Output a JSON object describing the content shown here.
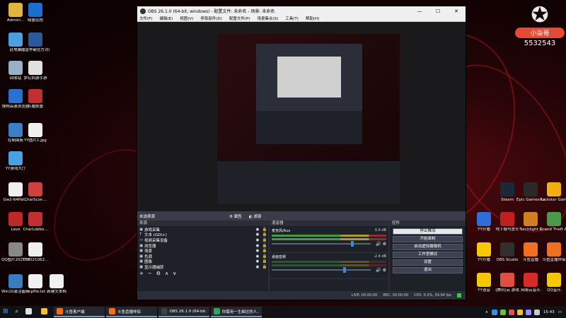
{
  "desktop": {
    "left_icons": [
      {
        "label": "Admini...",
        "color": "#e2b440"
      },
      {
        "label": "绿盟远程",
        "color": "#1a6fd1"
      },
      {
        "label": "此电脑",
        "color": "#4aa0e0"
      },
      {
        "label": "魔兽争霸官方对战平台",
        "color": "#2a5a9a"
      },
      {
        "label": "回收站",
        "color": "#9ab0c8"
      },
      {
        "label": "梦幻西游手游",
        "color": "#e0e0e0"
      },
      {
        "label": "搜狗高速浏览器",
        "color": "#2a70d0"
      },
      {
        "label": "斗魔联盟",
        "color": "#c03030"
      },
      {
        "label": "控制面板",
        "color": "#3a80c8"
      },
      {
        "label": "YY图片1.jpg",
        "color": "#f0f0f0"
      },
      {
        "label": "YY游戏大厅",
        "color": "#4aa0e0"
      },
      {
        "label": "Gw2-64Pat...",
        "color": "#f0f0f0"
      },
      {
        "label": "CharScon...",
        "color": "#d04040"
      },
      {
        "label": "Lave",
        "color": "#c02828"
      },
      {
        "label": "CharLobbo...",
        "color": "#c03030"
      },
      {
        "label": "QQ图片20210623...",
        "color": "#888"
      },
      {
        "label": "YY2021062...",
        "color": "#f0f0f0"
      },
      {
        "label": "Win10激活备用工具",
        "color": "#3a7cc0"
      },
      {
        "label": "tmpffw.txt",
        "color": "#f0f0f0"
      },
      {
        "label": "新建文本档",
        "color": "#f0f0f0"
      }
    ],
    "right_icons": [
      {
        "label": "Steam",
        "color": "#1b2838"
      },
      {
        "label": "Epic Games Launcher",
        "color": "#2a2a2a"
      },
      {
        "label": "Rockstar Games...",
        "color": "#f2b010"
      },
      {
        "label": "YY开播",
        "color": "#2d6fd9"
      },
      {
        "label": "地下城与勇士",
        "color": "#c02020"
      },
      {
        "label": "Torchlight II",
        "color": "#d08020"
      },
      {
        "label": "Grand Theft Auto V",
        "color": "#4a9a4a"
      },
      {
        "label": "YY开播",
        "color": "#f6c800"
      },
      {
        "label": "OBS Studio",
        "color": "#303030"
      },
      {
        "label": "斗鱼直播",
        "color": "#f07020"
      },
      {
        "label": "斗鱼直播伴侣",
        "color": "#f07020"
      },
      {
        "label": "YY语音",
        "color": "#f6c800"
      },
      {
        "label": "(腾讯)云 游戏",
        "color": "#e05040"
      },
      {
        "label": "网易云音乐",
        "color": "#d92a2a"
      },
      {
        "label": "QQ音乐",
        "color": "#f6c800"
      }
    ],
    "logo": {
      "name": "小柒哥",
      "number": "5532543"
    }
  },
  "obs": {
    "title": "OBS 26.1.0 (64-bit, windows) - 配置文件: 未命名 - 场景: 未命名",
    "menu": [
      "文件(F)",
      "编辑(E)",
      "视图(V)",
      "停靠部件(D)",
      "配置文件(P)",
      "场景集合(S)",
      "工具(T)",
      "帮助(H)"
    ],
    "window_buttons": [
      "—",
      "☐",
      "✕"
    ],
    "scene_bar": {
      "label": "未选择源",
      "properties": "属性",
      "filters": "滤镜"
    },
    "sources_header": "来源",
    "sources": [
      {
        "icon": "▣",
        "name": "游戏采集"
      },
      {
        "icon": "T",
        "name": "文本 (GDI+)"
      },
      {
        "icon": "▭",
        "name": "视频采集设备"
      },
      {
        "icon": "▣",
        "name": "浏览器"
      },
      {
        "icon": "▣",
        "name": "场景"
      },
      {
        "icon": "▣",
        "name": "色源"
      },
      {
        "icon": "▣",
        "name": "图像"
      },
      {
        "icon": "▣",
        "name": "显示器捕获"
      }
    ],
    "sources_toolbar": [
      "+",
      "−",
      "⚙",
      "∧",
      "∨"
    ],
    "mixer_header": "混音器",
    "mixer": [
      {
        "name": "麦克风/Aux",
        "db": "0.0 dB",
        "level": 0.8
      },
      {
        "name": "桌面音频",
        "db": "-2.4 dB",
        "level": 0.72
      }
    ],
    "controls_header": "控件",
    "controls": [
      "停止推流",
      "开始录制",
      "启动虚拟摄像机",
      "工作室模式",
      "设置",
      "退出"
    ],
    "status": {
      "live": "LIVE: 00:00:00",
      "rec": "REC: 00:00:00",
      "cpu": "CPU: 0.0%, 59.94 fps"
    }
  },
  "taskbar": {
    "items": [
      {
        "label": "",
        "color": "#e0e0e0",
        "open": false
      },
      {
        "label": "",
        "color": "#f0c040",
        "open": false
      },
      {
        "label": "斗鱼客户端",
        "color": "#f07020",
        "open": true
      },
      {
        "label": "斗鱼直播伴侣",
        "color": "#f07020",
        "open": true
      },
      {
        "label": "OBS 26.1.0 (64-bit...",
        "color": "#404040",
        "open": true
      },
      {
        "label": "你需用一生细过的人...",
        "color": "#3aa060",
        "open": true
      }
    ],
    "tray_icons": [
      "#3a90e0",
      "#6abf40",
      "#e05050",
      "#f0c040",
      "#9090ff",
      "#cccccc"
    ],
    "time": "15:43"
  }
}
